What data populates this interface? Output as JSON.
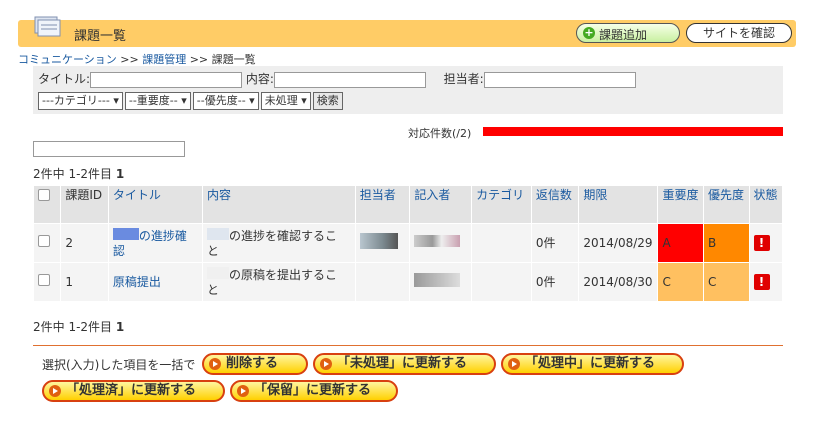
{
  "header": {
    "title": "課題一覧",
    "add_button": "課題追加",
    "site_button": "サイトを確認"
  },
  "breadcrumb": {
    "item1": "コミュニケーション",
    "sep": " >> ",
    "item2": "課題管理",
    "item3": "課題一覧"
  },
  "search": {
    "title_label": "タイトル:",
    "content_label": "内容:",
    "assignee_label": "担当者:",
    "category": "---カテゴリ---",
    "importance": "--重要度--",
    "priority": "--優先度--",
    "status": "未処理",
    "search_button": "検索"
  },
  "count": {
    "label": "対応件数(/2)",
    "fraction": 1.0
  },
  "pager": {
    "text": "2件中 1-2件目",
    "page": "1"
  },
  "table": {
    "headers": [
      "課題ID",
      "タイトル",
      "内容",
      "担当者",
      "記入者",
      "カテゴリ",
      "返信数",
      "期限",
      "重要度",
      "優先度",
      "状態"
    ],
    "rows": [
      {
        "id": "2",
        "title": "の進捗確認",
        "content_a": "の進捗を確認するこ",
        "content_b": "と",
        "replies": "0件",
        "due": "2014/08/29",
        "importance": "A",
        "priority": "B",
        "status_icon": "!"
      },
      {
        "id": "1",
        "title": "原稿提出",
        "content_a": "の原稿を提出するこ",
        "content_b": "と",
        "replies": "0件",
        "due": "2014/08/30",
        "importance": "C",
        "priority": "C",
        "status_icon": "!"
      }
    ]
  },
  "bulk": {
    "label": "選択(入力)した項目を一括で",
    "delete": "削除する",
    "unprocessed": "「未処理」に更新する",
    "processing": "「処理中」に更新する",
    "processed": "「処理済」に更新する",
    "hold": "「保留」に更新する"
  },
  "colors": {
    "header_bg": "#ffcc66",
    "count_bar": "#ff0000",
    "importance_A": "#ff0000",
    "priority_B": "#ff8800",
    "level_C": "#ffc060"
  }
}
